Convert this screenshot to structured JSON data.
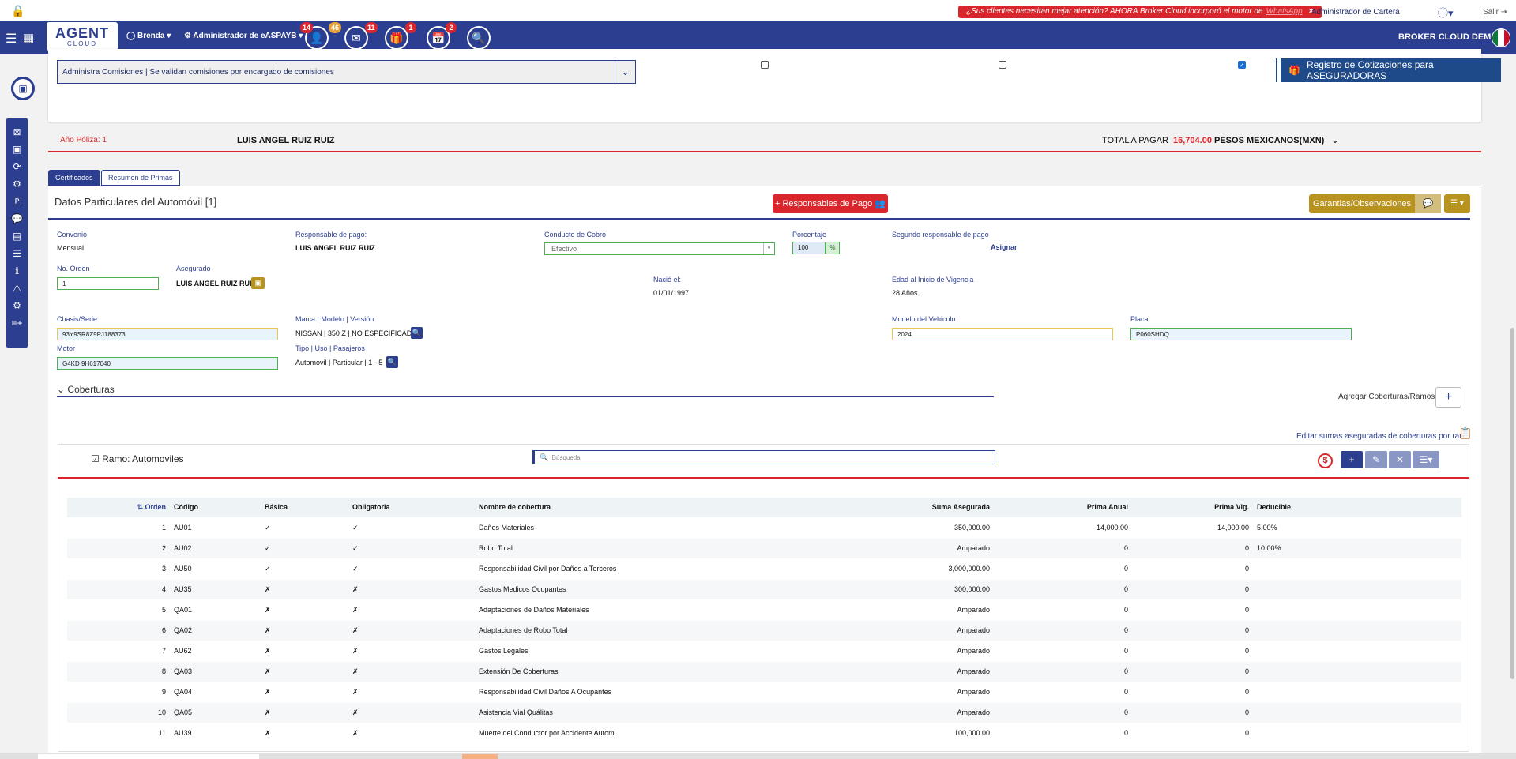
{
  "topbar": {
    "alert": "¿Sus clientes necesitan mejar atención? AHORA Broker Cloud incorporó el motor de",
    "alert_link": "WhatsApp",
    "alert_close": "×",
    "admin": "Administrador de Cartera",
    "help": "?",
    "salir": "Salir"
  },
  "navbar": {
    "logo_main": "AGENT",
    "logo_sub": "CLOUD",
    "user": "Brenda",
    "role": "Administrador de eASPAYB",
    "badges": {
      "contacts": "14",
      "contacts_alt": "46",
      "mail": "11",
      "gifts": "1",
      "calendar": "2"
    },
    "broker": "BROKER CLOUD DEMO"
  },
  "top_panel": {
    "commission_select": "Administra Comisiones | Se validan comisiones por encargado de comisiones",
    "registro_button": "Registro de Cotizaciones para ASEGURADORAS"
  },
  "poliza": {
    "anio": "Año Póliza: 1",
    "cliente": "LUIS ANGEL RUIZ RUIZ",
    "total_label": "TOTAL A PAGAR",
    "total_value": "16,704.00",
    "currency": "PESOS MEXICANOS(MXN)"
  },
  "tabs": [
    "Certificados",
    "Resumen de Primas"
  ],
  "datos": {
    "title": "Datos Particulares del Automóvil [1]",
    "resp_button": "+ Responsables de Pago",
    "garantias_button": "Garantias/Observaciones",
    "convenio_label": "Convenio",
    "convenio": "Mensual",
    "responsable_label": "Responsable de pago:",
    "responsable": "LUIS ANGEL RUIZ RUIZ",
    "conducto_label": "Conducto de Cobro",
    "conducto": "Efectivo",
    "porcentaje_label": "Porcentaje",
    "porcentaje": "100",
    "pct_sign": "%",
    "segundo_label": "Segundo responsable de pago",
    "asignar": "Asignar",
    "orden_label": "No. Orden",
    "orden": "1",
    "asegurado_label": "Asegurado",
    "asegurado": "LUIS ANGEL RUIZ RUIZ",
    "nacio_label": "Nació el:",
    "nacio": "01/01/1997",
    "edad_label": "Edad al Inicio de Vigencia",
    "edad": "28 Años",
    "chasis_label": "Chasis/Serie",
    "chasis": "93Y9SR8Z9PJ188373",
    "marca_label": "Marca | Modelo | Versión",
    "marca": "NISSAN | 350 Z | NO ESPECIFICADO",
    "modelo_label": "Modelo del Vehiculo",
    "modelo": "2024",
    "placa_label": "Placa",
    "placa": "P060SHDQ",
    "motor_label": "Motor",
    "motor": "G4KD 9H617040",
    "tipo_label": "Tipo | Uso | Pasajeros",
    "tipo": "Automovil | Particular | 1 - 5"
  },
  "coberturas": {
    "heading": "Coberturas",
    "agregar": "Agregar Coberturas/Ramos",
    "editar": "Editar sumas aseguradas de coberturas por ramo",
    "ramo": "Ramo: Automoviles",
    "search_placeholder": "Búsqueda",
    "columns": [
      "Orden",
      "Código",
      "Básica",
      "Obligatoria",
      "Nombre de cobertura",
      "Suma Asegurada",
      "Prima Anual",
      "Prima Vig.",
      "Deducible"
    ],
    "rows": [
      [
        "1",
        "AU01",
        "✓",
        "✓",
        "Daños Materiales",
        "350,000.00",
        "14,000.00",
        "14,000.00",
        "5.00%"
      ],
      [
        "2",
        "AU02",
        "✓",
        "✓",
        "Robo Total",
        "Amparado",
        "0",
        "0",
        "10.00%"
      ],
      [
        "3",
        "AU50",
        "✓",
        "✓",
        "Responsabilidad Civil por Daños a Terceros",
        "3,000,000.00",
        "0",
        "0",
        ""
      ],
      [
        "4",
        "AU35",
        "✗",
        "✗",
        "Gastos Medicos Ocupantes",
        "300,000.00",
        "0",
        "0",
        ""
      ],
      [
        "5",
        "QA01",
        "✗",
        "✗",
        "Adaptaciones de Daños Materiales",
        "Amparado",
        "0",
        "0",
        ""
      ],
      [
        "6",
        "QA02",
        "✗",
        "✗",
        "Adaptaciones de Robo Total",
        "Amparado",
        "0",
        "0",
        ""
      ],
      [
        "7",
        "AU62",
        "✗",
        "✗",
        "Gastos Legales",
        "Amparado",
        "0",
        "0",
        ""
      ],
      [
        "8",
        "QA03",
        "✗",
        "✗",
        "Extensión De Coberturas",
        "Amparado",
        "0",
        "0",
        ""
      ],
      [
        "9",
        "QA04",
        "✗",
        "✗",
        "Responsabilidad Civil Daños A Ocupantes",
        "Amparado",
        "0",
        "0",
        ""
      ],
      [
        "10",
        "QA05",
        "✗",
        "✗",
        "Asistencia Vial Quálitas",
        "Amparado",
        "0",
        "0",
        ""
      ],
      [
        "11",
        "AU39",
        "✗",
        "✗",
        "Muerte del Conductor por Accidente Autom.",
        "100,000.00",
        "0",
        "0",
        ""
      ]
    ]
  },
  "colors": {
    "navy": "#2c3e8f",
    "red": "#d9262c",
    "gold": "#b8931f"
  }
}
